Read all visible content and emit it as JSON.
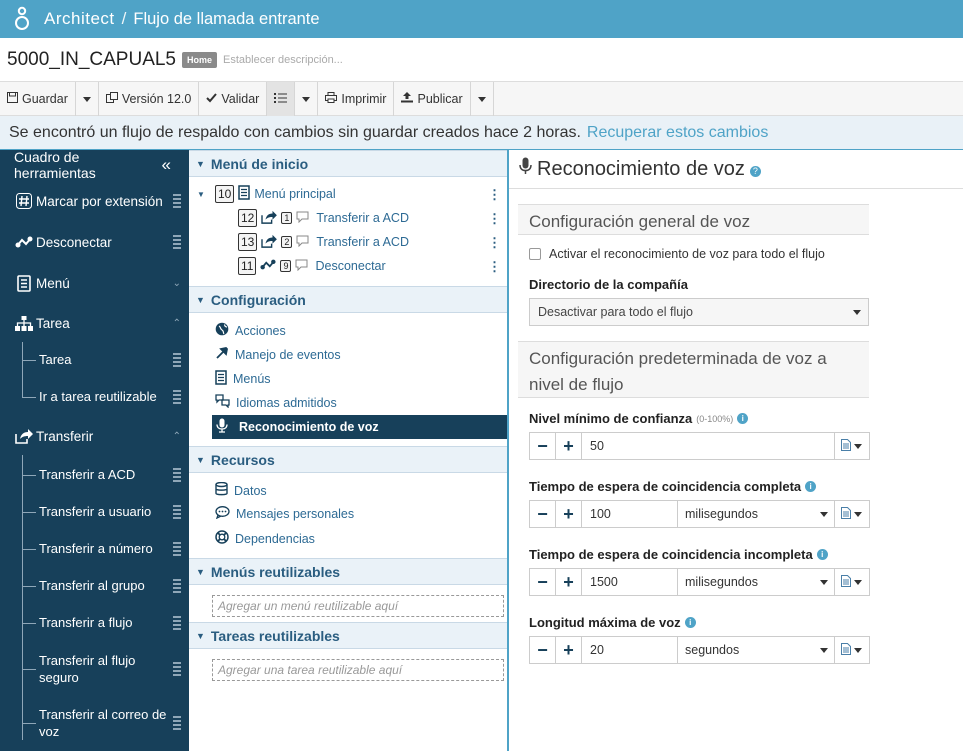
{
  "app": {
    "title": "Architect",
    "separator": "/",
    "flow_type": "Flujo de llamada entrante"
  },
  "flow": {
    "name": "5000_IN_CAPUAL5",
    "badge": "Home",
    "description_placeholder": "Establecer descripción..."
  },
  "toolbar": {
    "save": "Guardar",
    "version": "Versión 12.0",
    "validate": "Validar",
    "print": "Imprimir",
    "publish": "Publicar"
  },
  "banner": {
    "message": "Se encontró un flujo de respaldo con cambios sin guardar creados hace 2 horas.",
    "link": "Recuperar estos cambios"
  },
  "sidebar": {
    "title": "Cuadro de herramientas",
    "collapse_glyph": "«",
    "items": {
      "marcar": "Marcar por extensión",
      "desconectar": "Desconectar",
      "menu": "Menú",
      "tarea": "Tarea",
      "tarea_sub": "Tarea",
      "ir_tarea": "Ir a tarea reutilizable",
      "transferir": "Transferir",
      "t_acd": "Transferir a ACD",
      "t_usuario": "Transferir a usuario",
      "t_numero": "Transferir a número",
      "t_grupo": "Transferir al grupo",
      "t_flujo": "Transferir a flujo",
      "t_flujo_seguro": "Transferir al flujo seguro",
      "t_correo": "Transferir al correo de voz"
    }
  },
  "middle": {
    "start_menu": {
      "title": "Menú de inicio",
      "nodes": [
        {
          "num": "10",
          "label": "Menú principal"
        },
        {
          "num": "12",
          "key": "1",
          "label": "Transferir a ACD"
        },
        {
          "num": "13",
          "key": "2",
          "label": "Transferir a ACD"
        },
        {
          "num": "11",
          "key": "9",
          "label": "Desconectar"
        }
      ]
    },
    "config": {
      "title": "Configuración",
      "items": [
        "Acciones",
        "Manejo de eventos",
        "Menús",
        "Idiomas admitidos",
        "Reconocimiento de voz"
      ]
    },
    "resources": {
      "title": "Recursos",
      "items": [
        "Datos",
        "Mensajes personales",
        "Dependencias"
      ]
    },
    "reusable_menus": {
      "title": "Menús reutilizables",
      "placeholder": "Agregar un menú reutilizable aquí"
    },
    "reusable_tasks": {
      "title": "Tareas reutilizables",
      "placeholder": "Agregar una tarea reutilizable aquí"
    }
  },
  "panel": {
    "title": "Reconocimiento de voz",
    "general_header": "Configuración general de voz",
    "enable_all": "Activar el reconocimiento de voz para todo el flujo",
    "directory_label": "Directorio de la compañía",
    "directory_value": "Desactivar para todo el flujo",
    "defaults_header": "Configuración predeterminada de voz a nivel de flujo",
    "confidence": {
      "label": "Nivel mínimo de confianza",
      "hint": "(0-100%)",
      "value": "50"
    },
    "complete_timeout": {
      "label": "Tiempo de espera de coincidencia completa",
      "value": "100",
      "unit": "milisegundos"
    },
    "incomplete_timeout": {
      "label": "Tiempo de espera de coincidencia incompleta",
      "value": "1500",
      "unit": "milisegundos"
    },
    "max_speech": {
      "label": "Longitud máxima de voz",
      "value": "20",
      "unit": "segundos"
    },
    "minus": "−",
    "plus": "+",
    "info_glyph": "i",
    "help_glyph": "?"
  },
  "colors": {
    "topbar": "#4fa3c7",
    "sidebar": "#17405a",
    "link": "#4fa3c7",
    "selected": "#17405a"
  }
}
